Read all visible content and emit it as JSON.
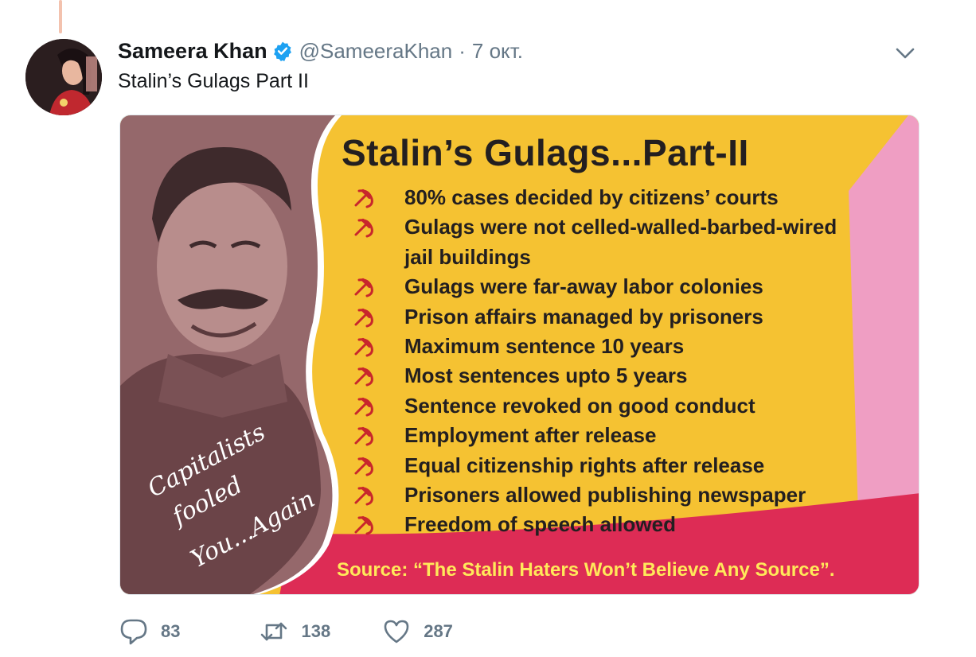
{
  "tweet": {
    "author_name": "Sameera Khan",
    "handle": "@SameeraKhan",
    "separator": "·",
    "date": "7 окт.",
    "text": "Stalin’s Gulags Part II",
    "avatar_icon": "profile-photo",
    "verified_icon": "verified-badge-icon",
    "menu_icon": "chevron-down-icon"
  },
  "media": {
    "title": "Stalin’s Gulags...Part-II",
    "facts": [
      "80% cases decided by citizens’ courts",
      "Gulags were not celled-walled-barbed-wired",
      "jail buildings",
      "Gulags were far-away labor colonies",
      "Prison affairs managed by prisoners",
      "Maximum sentence 10 years",
      "Most sentences upto 5 years",
      "Sentence revoked on good conduct",
      "Employment after release",
      "Equal citizenship rights after release",
      "Prisoners allowed publishing newspaper",
      "Freedom of speech allowed"
    ],
    "fact_has_bullet": [
      true,
      true,
      false,
      true,
      true,
      true,
      true,
      true,
      true,
      true,
      true,
      true
    ],
    "bullet_icon": "hammer-and-sickle-icon",
    "slogan_lines": [
      "Capitalists",
      "fooled",
      "You...Again"
    ],
    "source": "Source: “The Stalin Haters Won’t Believe Any Source”.",
    "colors": {
      "background": "#f5c232",
      "portrait_tint": "#8c5f63",
      "bottom_band": "#dd2c55",
      "side_pink": "#ef9ec3",
      "source_text": "#ffe95a",
      "bullet": "#c8262c"
    }
  },
  "actions": {
    "reply_count": "83",
    "retweet_count": "138",
    "like_count": "287",
    "reply_icon": "reply-icon",
    "retweet_icon": "retweet-icon",
    "like_icon": "heart-icon"
  },
  "colors": {
    "accent": "#1da1f2",
    "secondary_text": "#657786",
    "primary_text": "#14171a"
  }
}
